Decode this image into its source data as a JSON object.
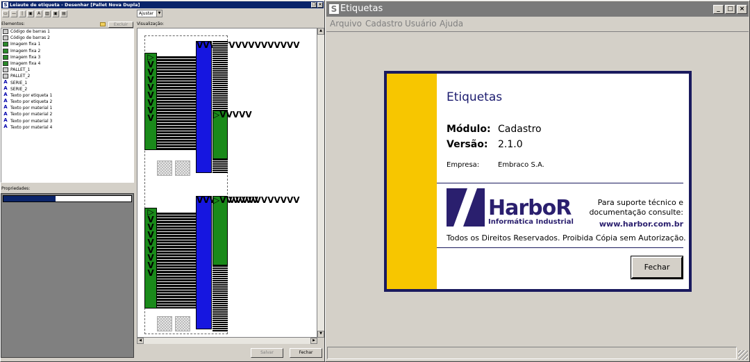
{
  "left_window": {
    "title": "Leiaute de etiqueta - Desenhar [Pallet Nova Dupla]",
    "toolbar": [
      "▭",
      "—",
      "|",
      "▣",
      "A",
      "▥",
      "▣",
      "▤"
    ],
    "zoom_select": "Ajustar",
    "elements_label": "Elementos:",
    "delete_button": "Excluir",
    "preview_label": "Visualização:",
    "properties_label": "Propriedades:",
    "elements": [
      {
        "label": "Código de barras 1",
        "icon": "barcode-icon"
      },
      {
        "label": "Código de barras 2",
        "icon": "barcode-icon"
      },
      {
        "label": "Imagem fixa 1",
        "icon": "image-icon"
      },
      {
        "label": "Imagem fixa 2",
        "icon": "image-icon"
      },
      {
        "label": "Imagem fixa 3",
        "icon": "image-icon"
      },
      {
        "label": "Imagem fixa 4",
        "icon": "image-icon"
      },
      {
        "label": "PALLET_1",
        "icon": "barcode-icon"
      },
      {
        "label": "PALLET_2",
        "icon": "barcode-icon"
      },
      {
        "label": "SERIE_1",
        "icon": "text-gear-icon"
      },
      {
        "label": "SERIE_2",
        "icon": "text-gear-icon"
      },
      {
        "label": "Texto por etiqueta 1",
        "icon": "text-gear-icon"
      },
      {
        "label": "Texto por etiqueta 2",
        "icon": "text-gear-icon"
      },
      {
        "label": "Texto por material 1",
        "icon": "text-icon"
      },
      {
        "label": "Texto por material 2",
        "icon": "text-icon"
      },
      {
        "label": "Texto por material 3",
        "icon": "text-icon"
      },
      {
        "label": "Texto por material 4",
        "icon": "text-icon"
      }
    ],
    "save_button": "Salvar",
    "close_button": "Fechar"
  },
  "main_window": {
    "title": "Etiquetas",
    "menu": [
      "Arquivo",
      "Cadastro",
      "Usuário",
      "Ajuda"
    ]
  },
  "about": {
    "title": "Etiquetas",
    "module_label": "Módulo:",
    "module_value": "Cadastro",
    "version_label": "Versão:",
    "version_value": "2.1.0",
    "company_label": "Empresa:",
    "company_value": "Embraco S.A.",
    "brand": "HarboR",
    "brand_sub": "Informática Industrial",
    "support_line1": "Para suporte técnico e",
    "support_line2": "documentação consulte:",
    "url": "www.harbor.com.br",
    "rights": "Todos os Direitos Reservados. Proibida Cópia sem Autorização.",
    "close_button": "Fechar",
    "colors": {
      "accent": "#f7c600",
      "frame": "#1a1a5e",
      "brand": "#2a1f6e"
    }
  }
}
